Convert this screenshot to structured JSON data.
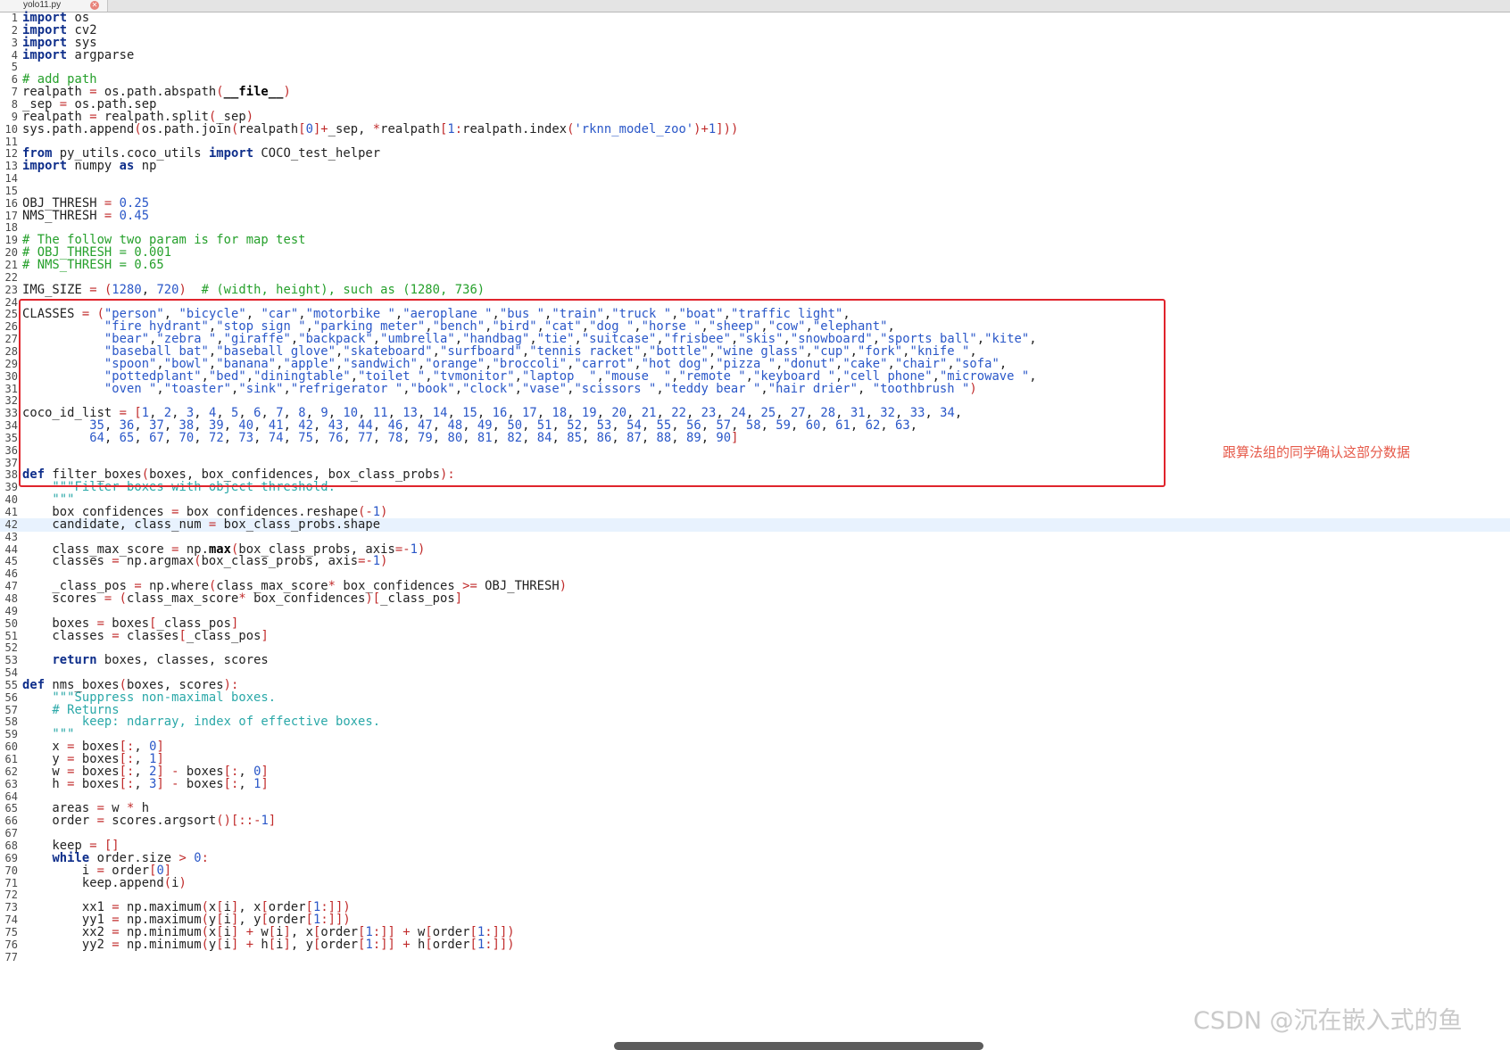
{
  "tab": {
    "title": "yolo11.py"
  },
  "editor": {
    "current_line": 42,
    "lines": [
      {
        "n": "1",
        "t": "import os"
      },
      {
        "n": "2",
        "t": "import cv2"
      },
      {
        "n": "3",
        "t": "import sys"
      },
      {
        "n": "4",
        "t": "import argparse"
      },
      {
        "n": "5",
        "t": ""
      },
      {
        "n": "6",
        "t": "# add path"
      },
      {
        "n": "7",
        "t": "realpath = os.path.abspath(__file__)"
      },
      {
        "n": "8",
        "t": "_sep = os.path.sep"
      },
      {
        "n": "9",
        "t": "realpath = realpath.split(_sep)"
      },
      {
        "n": "10",
        "t": "sys.path.append(os.path.join(realpath[0]+_sep, *realpath[1:realpath.index('rknn_model_zoo')+1]))"
      },
      {
        "n": "11",
        "t": ""
      },
      {
        "n": "12",
        "t": "from py_utils.coco_utils import COCO_test_helper"
      },
      {
        "n": "13",
        "t": "import numpy as np"
      },
      {
        "n": "14",
        "t": ""
      },
      {
        "n": "15",
        "t": ""
      },
      {
        "n": "16",
        "t": "OBJ_THRESH = 0.25"
      },
      {
        "n": "17",
        "t": "NMS_THRESH = 0.45"
      },
      {
        "n": "18",
        "t": ""
      },
      {
        "n": "19",
        "t": "# The follow two param is for map test"
      },
      {
        "n": "20",
        "t": "# OBJ_THRESH = 0.001"
      },
      {
        "n": "21",
        "t": "# NMS_THRESH = 0.65"
      },
      {
        "n": "22",
        "t": ""
      },
      {
        "n": "23",
        "t": "IMG_SIZE = (1280, 720)  # (width, height), such as (1280, 736)"
      },
      {
        "n": "24",
        "t": ""
      },
      {
        "n": "25",
        "t": "CLASSES = (\"person\", \"bicycle\", \"car\",\"motorbike \",\"aeroplane \",\"bus \",\"train\",\"truck \",\"boat\",\"traffic light\","
      },
      {
        "n": "26",
        "t": "           \"fire hydrant\",\"stop sign \",\"parking meter\",\"bench\",\"bird\",\"cat\",\"dog \",\"horse \",\"sheep\",\"cow\",\"elephant\","
      },
      {
        "n": "27",
        "t": "           \"bear\",\"zebra \",\"giraffe\",\"backpack\",\"umbrella\",\"handbag\",\"tie\",\"suitcase\",\"frisbee\",\"skis\",\"snowboard\",\"sports ball\",\"kite\","
      },
      {
        "n": "28",
        "t": "           \"baseball bat\",\"baseball glove\",\"skateboard\",\"surfboard\",\"tennis racket\",\"bottle\",\"wine glass\",\"cup\",\"fork\",\"knife \","
      },
      {
        "n": "29",
        "t": "           \"spoon\",\"bowl\",\"banana\",\"apple\",\"sandwich\",\"orange\",\"broccoli\",\"carrot\",\"hot dog\",\"pizza \",\"donut\",\"cake\",\"chair\",\"sofa\","
      },
      {
        "n": "30",
        "t": "           \"pottedplant\",\"bed\",\"diningtable\",\"toilet \",\"tvmonitor\",\"laptop  \",\"mouse  \",\"remote \",\"keyboard \",\"cell phone\",\"microwave \","
      },
      {
        "n": "31",
        "t": "           \"oven \",\"toaster\",\"sink\",\"refrigerator \",\"book\",\"clock\",\"vase\",\"scissors \",\"teddy bear \",\"hair drier\", \"toothbrush \")"
      },
      {
        "n": "32",
        "t": ""
      },
      {
        "n": "33",
        "t": "coco_id_list = [1, 2, 3, 4, 5, 6, 7, 8, 9, 10, 11, 13, 14, 15, 16, 17, 18, 19, 20, 21, 22, 23, 24, 25, 27, 28, 31, 32, 33, 34,"
      },
      {
        "n": "34",
        "t": "         35, 36, 37, 38, 39, 40, 41, 42, 43, 44, 46, 47, 48, 49, 50, 51, 52, 53, 54, 55, 56, 57, 58, 59, 60, 61, 62, 63,"
      },
      {
        "n": "35",
        "t": "         64, 65, 67, 70, 72, 73, 74, 75, 76, 77, 78, 79, 80, 81, 82, 84, 85, 86, 87, 88, 89, 90]"
      },
      {
        "n": "36",
        "t": ""
      },
      {
        "n": "37",
        "t": ""
      },
      {
        "n": "38",
        "t": "def filter_boxes(boxes, box_confidences, box_class_probs):"
      },
      {
        "n": "39",
        "t": "    \"\"\"Filter boxes with object threshold."
      },
      {
        "n": "40",
        "t": "    \"\"\""
      },
      {
        "n": "41",
        "t": "    box_confidences = box_confidences.reshape(-1)"
      },
      {
        "n": "42",
        "t": "    candidate, class_num = box_class_probs.shape"
      },
      {
        "n": "43",
        "t": ""
      },
      {
        "n": "44",
        "t": "    class_max_score = np.max(box_class_probs, axis=-1)"
      },
      {
        "n": "45",
        "t": "    classes = np.argmax(box_class_probs, axis=-1)"
      },
      {
        "n": "46",
        "t": ""
      },
      {
        "n": "47",
        "t": "    _class_pos = np.where(class_max_score* box_confidences >= OBJ_THRESH)"
      },
      {
        "n": "48",
        "t": "    scores = (class_max_score* box_confidences)[_class_pos]"
      },
      {
        "n": "49",
        "t": ""
      },
      {
        "n": "50",
        "t": "    boxes = boxes[_class_pos]"
      },
      {
        "n": "51",
        "t": "    classes = classes[_class_pos]"
      },
      {
        "n": "52",
        "t": ""
      },
      {
        "n": "53",
        "t": "    return boxes, classes, scores"
      },
      {
        "n": "54",
        "t": ""
      },
      {
        "n": "55",
        "t": "def nms_boxes(boxes, scores):"
      },
      {
        "n": "56",
        "t": "    \"\"\"Suppress non-maximal boxes."
      },
      {
        "n": "57",
        "t": "    # Returns"
      },
      {
        "n": "58",
        "t": "        keep: ndarray, index of effective boxes."
      },
      {
        "n": "59",
        "t": "    \"\"\""
      },
      {
        "n": "60",
        "t": "    x = boxes[:, 0]"
      },
      {
        "n": "61",
        "t": "    y = boxes[:, 1]"
      },
      {
        "n": "62",
        "t": "    w = boxes[:, 2] - boxes[:, 0]"
      },
      {
        "n": "63",
        "t": "    h = boxes[:, 3] - boxes[:, 1]"
      },
      {
        "n": "64",
        "t": ""
      },
      {
        "n": "65",
        "t": "    areas = w * h"
      },
      {
        "n": "66",
        "t": "    order = scores.argsort()[::-1]"
      },
      {
        "n": "67",
        "t": ""
      },
      {
        "n": "68",
        "t": "    keep = []"
      },
      {
        "n": "69",
        "t": "    while order.size > 0:"
      },
      {
        "n": "70",
        "t": "        i = order[0]"
      },
      {
        "n": "71",
        "t": "        keep.append(i)"
      },
      {
        "n": "72",
        "t": ""
      },
      {
        "n": "73",
        "t": "        xx1 = np.maximum(x[i], x[order[1:]])"
      },
      {
        "n": "74",
        "t": "        yy1 = np.maximum(y[i], y[order[1:]])"
      },
      {
        "n": "75",
        "t": "        xx2 = np.minimum(x[i] + w[i], x[order[1:]] + w[order[1:]])"
      },
      {
        "n": "76",
        "t": "        yy2 = np.minimum(y[i] + h[i], y[order[1:]] + h[order[1:]])"
      },
      {
        "n": "77",
        "t": ""
      }
    ]
  },
  "annotation": {
    "text": "跟算法组的同学确认这部分数据"
  },
  "watermark": {
    "text": "CSDN @沉在嵌入式的鱼"
  },
  "colors": {
    "highlight_box": "#e0242c",
    "annotation": "#e65a4a",
    "current_line": "#e8f2fe",
    "keyword": "#0d2d8a",
    "string": "#2a57c8",
    "comment": "#25a02b",
    "docstring": "#2aa8a8"
  },
  "icons": {
    "tab_close": "close-icon"
  }
}
